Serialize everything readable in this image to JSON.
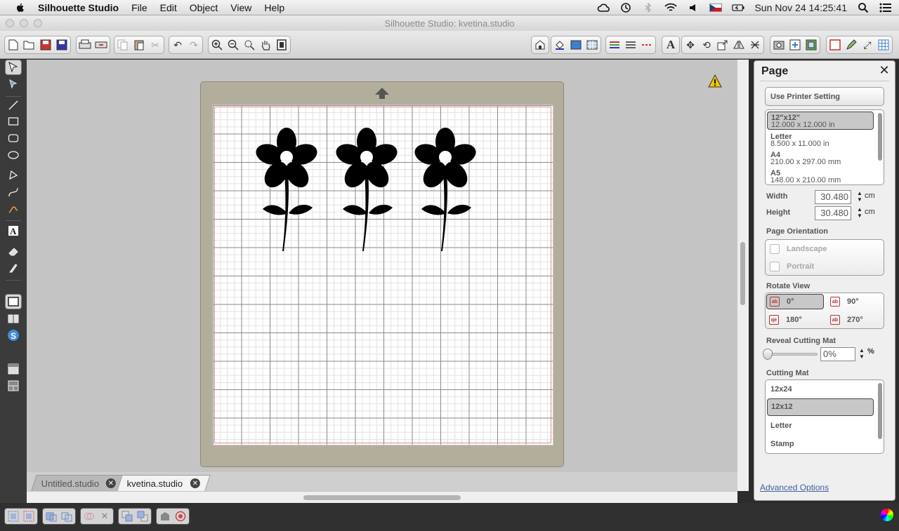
{
  "menubar": {
    "app_name": "Silhouette Studio",
    "menus": [
      "File",
      "Edit",
      "Object",
      "View",
      "Help"
    ],
    "clock": "Sun Nov 24  14:25:41"
  },
  "window": {
    "title": "Silhouette Studio: kvetina.studio"
  },
  "tabs": [
    {
      "label": "Untitled.studio",
      "active": false
    },
    {
      "label": "kvetina.studio",
      "active": true
    }
  ],
  "colors": {
    "accent_link": "#3f5f9f",
    "mat": "#b3ae9c",
    "cut_margin": "#e08b8b",
    "design": "#000000"
  },
  "panel": {
    "title": "Page",
    "use_printer_setting": "Use Printer Setting",
    "page_sizes": [
      {
        "name": "12\"x12\"",
        "dims": "12.000 x 12.000 in",
        "selected": true
      },
      {
        "name": "Letter",
        "dims": "8.500 x 11.000 in",
        "selected": false
      },
      {
        "name": "A4",
        "dims": "210.00 x 297.00 mm",
        "selected": false
      },
      {
        "name": "A5",
        "dims": "148.00 x 210.00 mm",
        "selected": false
      }
    ],
    "width_label": "Width",
    "width_value": "30.480",
    "height_label": "Height",
    "height_value": "30.480",
    "unit": "cm",
    "orientation_label": "Page Orientation",
    "orientation_options": [
      "Landscape",
      "Portrait"
    ],
    "rotate_label": "Rotate View",
    "rotate_options": [
      {
        "label": "0°",
        "icon": "ab",
        "selected": true
      },
      {
        "label": "90°",
        "icon": "ab",
        "selected": false
      },
      {
        "label": "180°",
        "icon": "qe",
        "selected": false
      },
      {
        "label": "270°",
        "icon": "ab",
        "selected": false
      }
    ],
    "reveal_label": "Reveal Cutting Mat",
    "reveal_value": "0%",
    "reveal_unit": "%",
    "reveal_level": 0,
    "cutting_mat_label": "Cutting Mat",
    "cutting_mats": [
      {
        "label": "12x24",
        "selected": false
      },
      {
        "label": "12x12",
        "selected": true
      },
      {
        "label": "Letter",
        "selected": false
      },
      {
        "label": "Stamp",
        "selected": false
      }
    ],
    "advanced_options": "Advanced Options"
  }
}
